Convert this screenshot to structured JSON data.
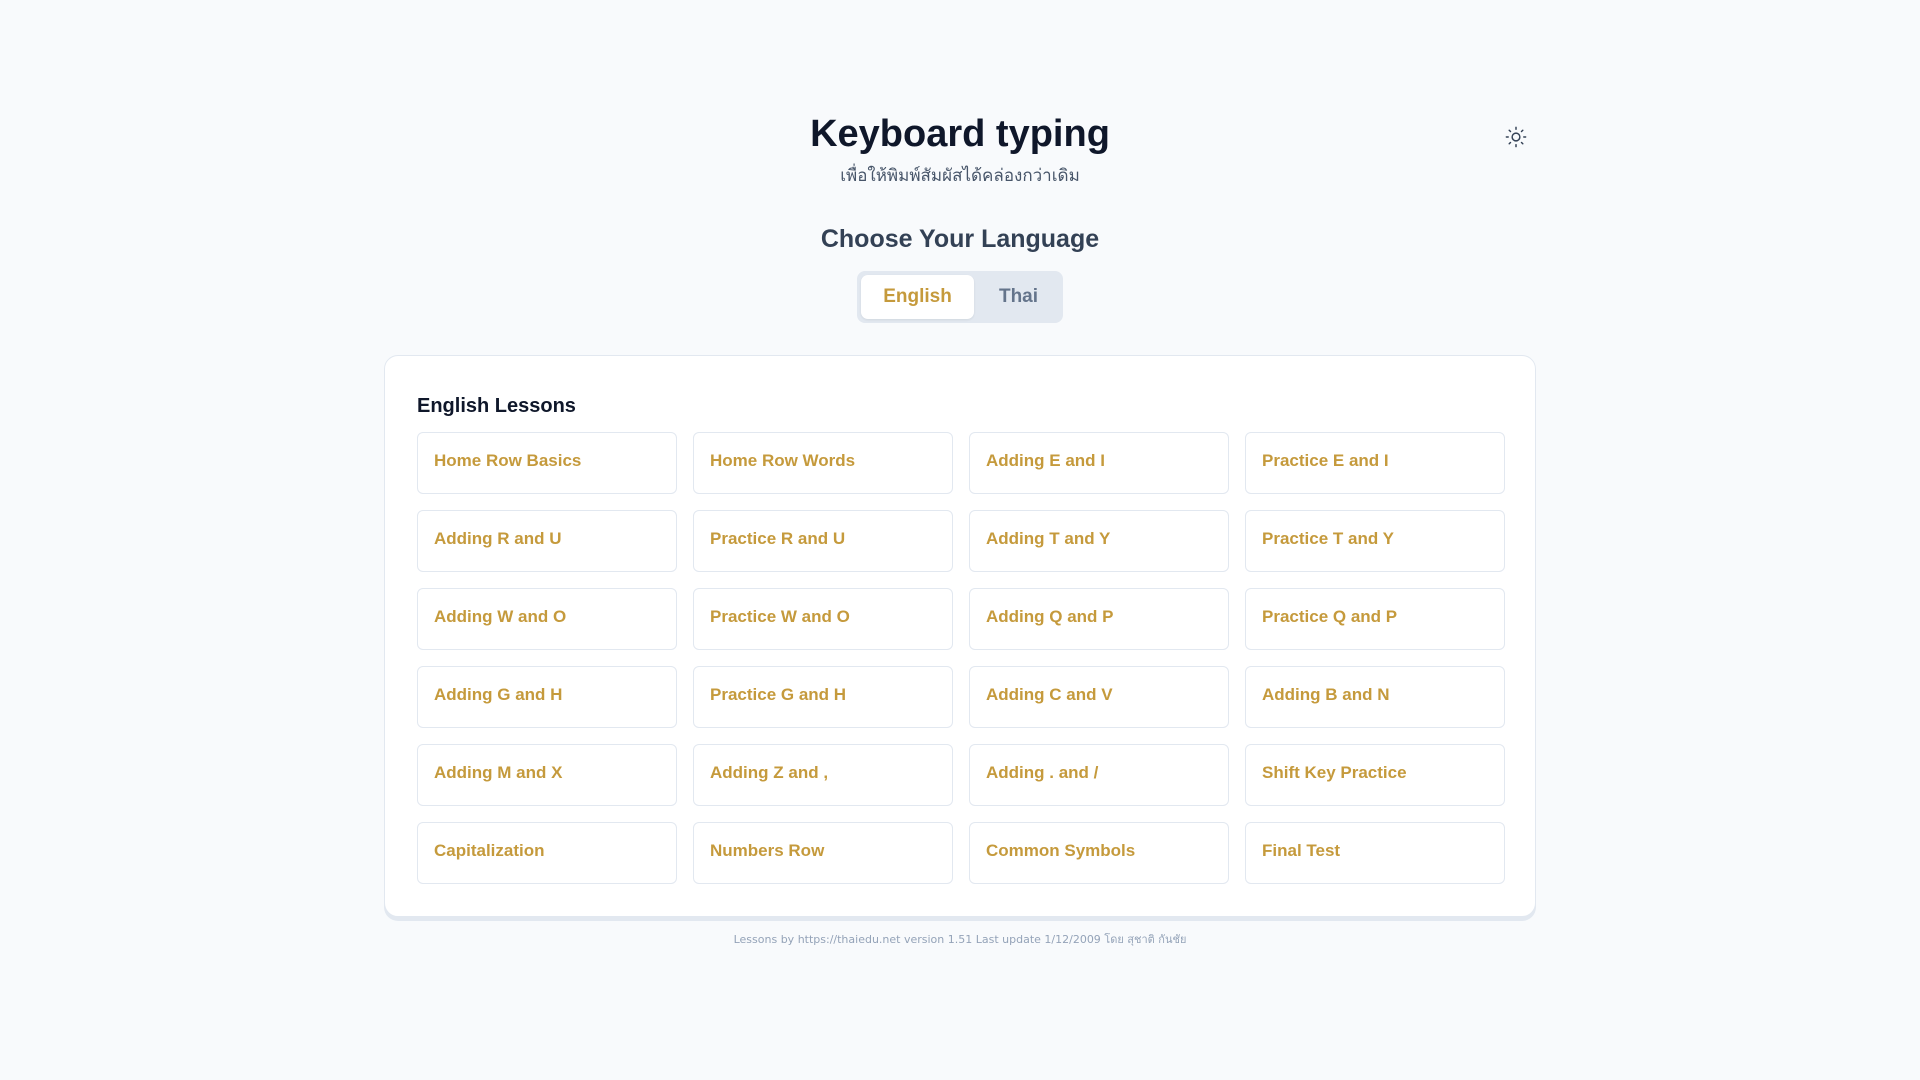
{
  "header": {
    "title": "Keyboard typing",
    "subtitle": "เพื่อให้พิมพ์สัมผัสได้คล่องกว่าเดิม",
    "theme_icon": "sun-icon"
  },
  "language": {
    "heading": "Choose Your Language",
    "options": [
      {
        "label": "English",
        "active": true
      },
      {
        "label": "Thai",
        "active": false
      }
    ]
  },
  "lessons": {
    "title": "English Lessons",
    "items": [
      "Home Row Basics",
      "Home Row Words",
      "Adding E and I",
      "Practice E and I",
      "Adding R and U",
      "Practice R and U",
      "Adding T and Y",
      "Practice T and Y",
      "Adding W and O",
      "Practice W and O",
      "Adding Q and P",
      "Practice Q and P",
      "Adding G and H",
      "Practice G and H",
      "Adding C and V",
      "Adding B and N",
      "Adding M and X",
      "Adding Z and ,",
      "Adding . and /",
      "Shift Key Practice",
      "Capitalization",
      "Numbers Row",
      "Common Symbols",
      "Final Test"
    ]
  },
  "footer": {
    "text": "Lessons by https://thaiedu.net version 1.51 Last update 1/12/2009 โดย สุชาติ กันชัย"
  },
  "colors": {
    "accent": "#c59a3c",
    "background": "#f8fafc",
    "title": "#0f172a"
  }
}
